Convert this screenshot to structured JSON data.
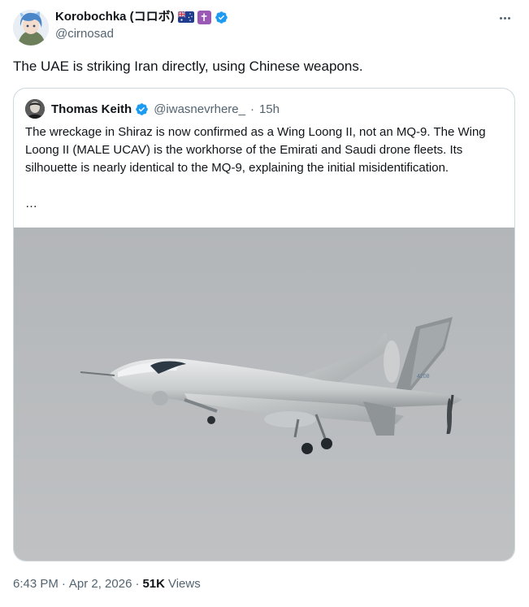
{
  "author": {
    "display_name": "Korobochka (コロボ)",
    "handle": "@cirnosad",
    "avatar": "anime-avatar-icon",
    "emojis": [
      "australia-flag-icon",
      "latin-cross-icon"
    ],
    "verified": true
  },
  "tweet": {
    "text": "The UAE is striking Iran directly, using Chinese weapons."
  },
  "quoted": {
    "display_name": "Thomas Keith",
    "handle": "@iwasnevrhere_",
    "separator": "·",
    "time": "15h",
    "verified": true,
    "body": "The wreckage in Shiraz is now confirmed as a Wing Loong II, not an MQ-9. The Wing Loong II (MALE UCAV) is the workhorse of the Emirati and Saudi drone fleets. Its silhouette is nearly identical to the MQ-9, explaining the initial misidentification.",
    "ellipsis": "…",
    "media": "drone-in-flight-photo"
  },
  "footer": {
    "time": "6:43 PM",
    "separator1": "·",
    "date": "Apr 2, 2026",
    "separator2": "·",
    "views_count": "51K",
    "views_label": "Views"
  },
  "colors": {
    "verified_blue": "#1d9bf0",
    "secondary_text": "#536471",
    "border": "#cfd9de",
    "sky": "#b9bcbe"
  }
}
